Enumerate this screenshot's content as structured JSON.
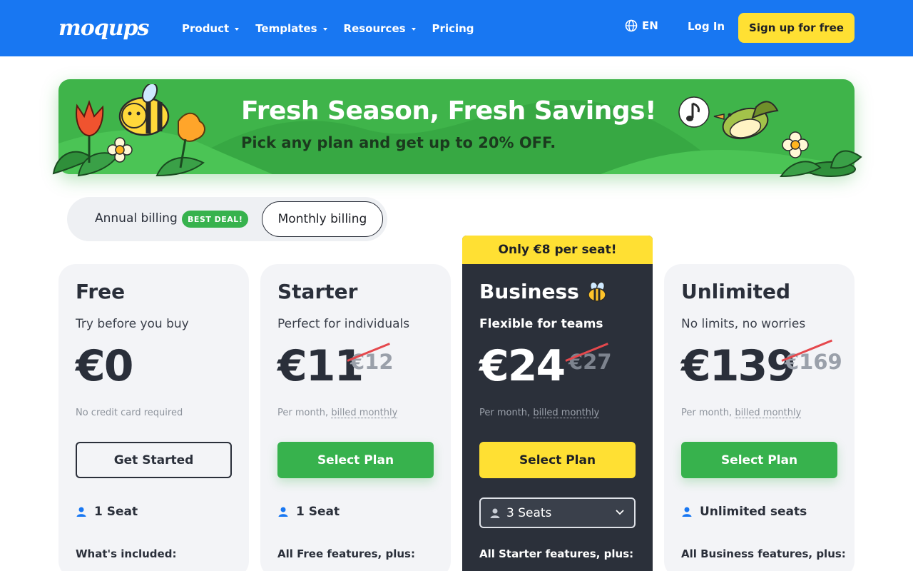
{
  "header": {
    "logo": "moqups",
    "nav": [
      {
        "label": "Product",
        "dropdown": true
      },
      {
        "label": "Templates",
        "dropdown": true
      },
      {
        "label": "Resources",
        "dropdown": true
      },
      {
        "label": "Pricing",
        "dropdown": false
      }
    ],
    "language": "EN",
    "login_label": "Log In",
    "signup_label": "Sign up for free"
  },
  "banner": {
    "title": "Fresh Season, Fresh Savings!",
    "subtitle": "Pick any plan and get up to 20% OFF."
  },
  "billing": {
    "annual_label": "Annual billing",
    "badge": "BEST DEAL!",
    "monthly_label": "Monthly billing",
    "selected": "monthly"
  },
  "plans": [
    {
      "name": "Free",
      "tagline": "Try before you buy",
      "price": "€0",
      "old_price": "",
      "period_prefix": "No credit card required",
      "period_link": "",
      "button": "Get Started",
      "seats": "1 Seat",
      "included": "What's included:"
    },
    {
      "name": "Starter",
      "tagline": "Perfect for individuals",
      "price": "€11",
      "old_price": "€12",
      "period_prefix": "Per month, ",
      "period_link": "billed monthly",
      "button": "Select Plan",
      "seats": "1 Seat",
      "included": "All Free features, plus:"
    },
    {
      "name": "Business",
      "ribbon": "Only €8 per seat!",
      "tagline": "Flexible for teams",
      "price": "€24",
      "old_price": "€27",
      "period_prefix": "Per month, ",
      "period_link": "billed monthly",
      "button": "Select Plan",
      "seats": "3 Seats",
      "included": "All Starter features, plus:"
    },
    {
      "name": "Unlimited",
      "tagline": "No limits, no worries",
      "price": "€139",
      "old_price": "€169",
      "period_prefix": "Per month, ",
      "period_link": "billed monthly",
      "button": "Select Plan",
      "seats": "Unlimited seats",
      "included": "All Business features, plus:"
    }
  ],
  "colors": {
    "brand_blue": "#1877f2",
    "accent_yellow": "#ffe033",
    "accent_green": "#37b24d",
    "dark_card": "#2b303a"
  }
}
